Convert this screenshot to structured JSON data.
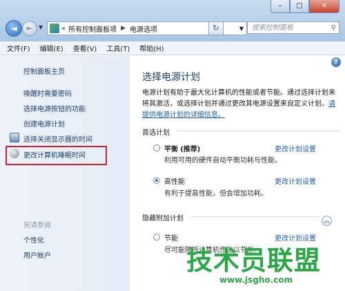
{
  "window": {
    "caption_buttons": [
      "–",
      "□",
      "✕"
    ]
  },
  "nav": {
    "back_glyph": "◄",
    "forward_glyph": "►",
    "address": {
      "prefix": "«",
      "crumbs": [
        "所有控制面板项",
        "电源选项"
      ]
    },
    "search_placeholder": "搜索控制面板"
  },
  "menubar": [
    "文件(F)",
    "编辑(E)",
    "查看(V)",
    "工具(T)",
    "帮助(H)"
  ],
  "sidebar": {
    "home": "控制面板主页",
    "links": [
      "唤醒时需要密码",
      "选择电源按钮的功能",
      "创建电源计划",
      "选择关闭显示器的时间",
      "更改计算机睡眠时间"
    ],
    "see_also_title": "另请参阅",
    "see_also": [
      "个性化",
      "用户帐户"
    ]
  },
  "main": {
    "title": "选择电源计划",
    "description": "电源计划有助于最大化计算机的性能或者节能。通过选择计划来将其激活，或选择计划并通过更改其电源设置来自定义计划。",
    "link": "请提供电源计划的详细信息。",
    "preferred_group": "首选计划",
    "plans": [
      {
        "name": "平衡",
        "tag": "(推荐)",
        "description": "利用可用的硬件自动平衡功耗与性能。",
        "link": "更改计划设置",
        "selected": false
      },
      {
        "name": "高性能",
        "tag": "",
        "description": "有利于提高性能，但会增加功耗。",
        "link": "更改计划设置",
        "selected": true
      }
    ],
    "hidden_group": "隐藏附加计划",
    "hidden_plans": [
      {
        "name": "节能",
        "description": "尽可能降低计算机性能以节能。",
        "link": "更改计划设置",
        "selected": false
      }
    ]
  },
  "watermark": {
    "brand": "技术员联盟",
    "url": "www.jsgho.com"
  }
}
